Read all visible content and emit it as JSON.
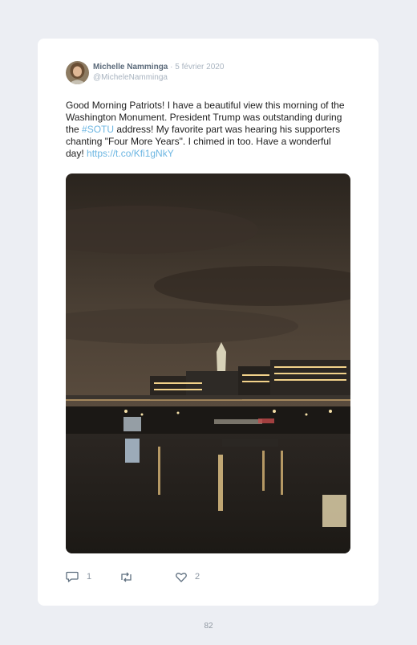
{
  "tweet": {
    "author_name": "Michelle Namminga",
    "separator": "·",
    "date": "5 février 2020",
    "handle": "@MicheleNamminga",
    "text_1": "Good Morning Patriots! I have a beautiful view this morning of the Washington Monument. President Trump was outstanding during the ",
    "hashtag": "#SOTU",
    "text_2": " address! My favorite part was hearing his supporters chanting \"Four More Years\". I chimed in too. Have a wonderful day! ",
    "link": "https://t.co/Kfi1gNkY"
  },
  "actions": {
    "reply_count": "1",
    "like_count": "2"
  },
  "footer": {
    "page_number": "82"
  },
  "icons": {
    "reply": "comment-icon",
    "retweet": "retweet-icon",
    "like": "heart-icon"
  },
  "colors": {
    "link": "#6cb6e2",
    "name": "#5b6a7a",
    "muted": "#a9b4c0"
  }
}
